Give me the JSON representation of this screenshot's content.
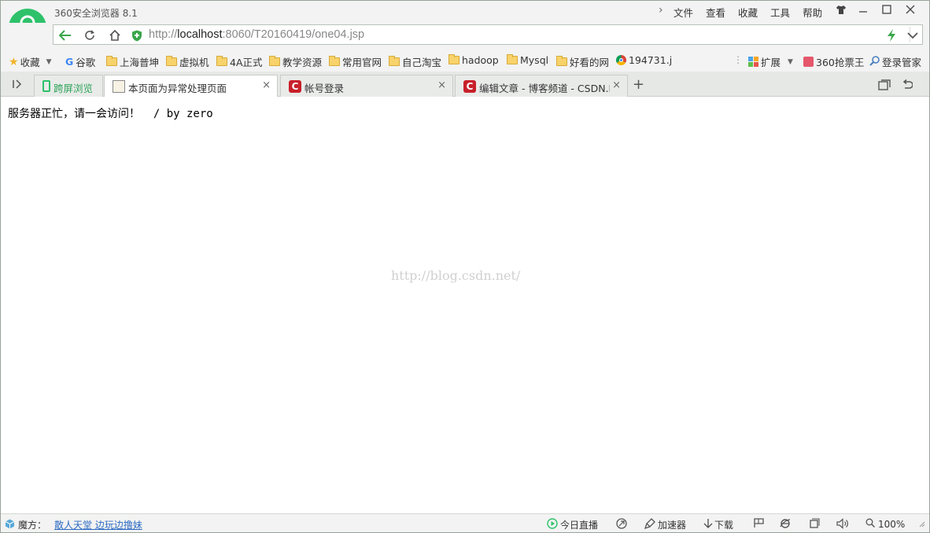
{
  "window": {
    "title": "360安全浏览器 8.1"
  },
  "menu": {
    "items": [
      "文件",
      "查看",
      "收藏",
      "工具",
      "帮助"
    ]
  },
  "address": {
    "url_scheme": "http://",
    "url_host": "localhost",
    "url_rest": ":8060/T20160419/one04.jsp"
  },
  "bookmarks": {
    "favorites": "收藏",
    "google": "谷歌",
    "items": [
      "上海普坤",
      "虚拟机",
      "4A正式",
      "教学资源",
      "常用官网",
      "自己淘宝",
      "hadoop",
      "Mysql",
      "好看的网"
    ],
    "last": "194731.j",
    "extensions": "扩展",
    "ticket": "360抢票王",
    "login_manager": "登录管家"
  },
  "tabs": {
    "cross_screen": "跨屏浏览",
    "items": [
      {
        "label": "本页面为异常处理页面",
        "active": true
      },
      {
        "label": "帐号登录",
        "active": false
      },
      {
        "label": "编辑文章 - 博客频道 - CSDN.N",
        "active": false
      }
    ]
  },
  "content": {
    "message": "服务器正忙，请一会访问！  / by zero",
    "watermark": "http://blog.csdn.net/"
  },
  "statusbar": {
    "mofang_label": "魔方：",
    "mofang_link": "散人天堂 边玩边撸妹",
    "live": "今日直播",
    "accelerator": "加速器",
    "download": "下载",
    "zoom": "100%"
  },
  "colors": {
    "accent": "#2ec16a",
    "tab_icon": "#c8202a"
  }
}
